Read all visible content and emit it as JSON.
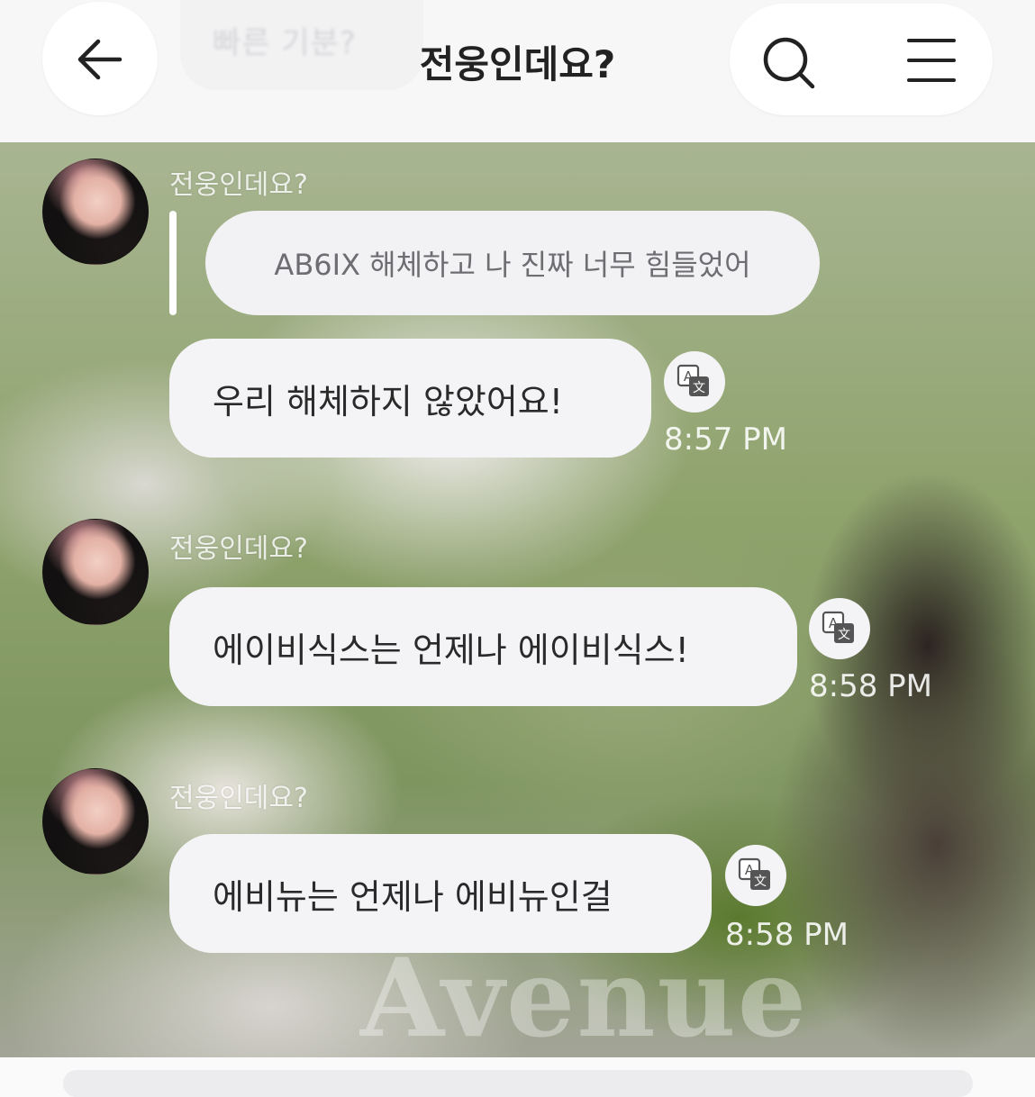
{
  "header": {
    "title": "전웅인데요?",
    "ghost_text": "빠른 기분?",
    "back_icon": "arrow-left-icon",
    "search_icon": "search-icon",
    "menu_icon": "hamburger-menu-icon"
  },
  "messages": [
    {
      "sender": "전웅인데요?",
      "reply_to": "AB6IX 해체하고 나 진짜 너무 힘들었어",
      "text": "우리 해체하지 않았어요!",
      "time": "8:57 PM"
    },
    {
      "sender": "전웅인데요?",
      "text": "에이비식스는 언제나 에이비식스!",
      "time": "8:58 PM"
    },
    {
      "sender": "전웅인데요?",
      "text": "에비뉴는 언제나 에비뉴인걸",
      "time": "8:58 PM"
    }
  ],
  "background": {
    "watermark": "Avenue"
  },
  "colors": {
    "bubble": "#f4f4f6",
    "title": "#222222",
    "header_bg": "#f7f7f8"
  }
}
